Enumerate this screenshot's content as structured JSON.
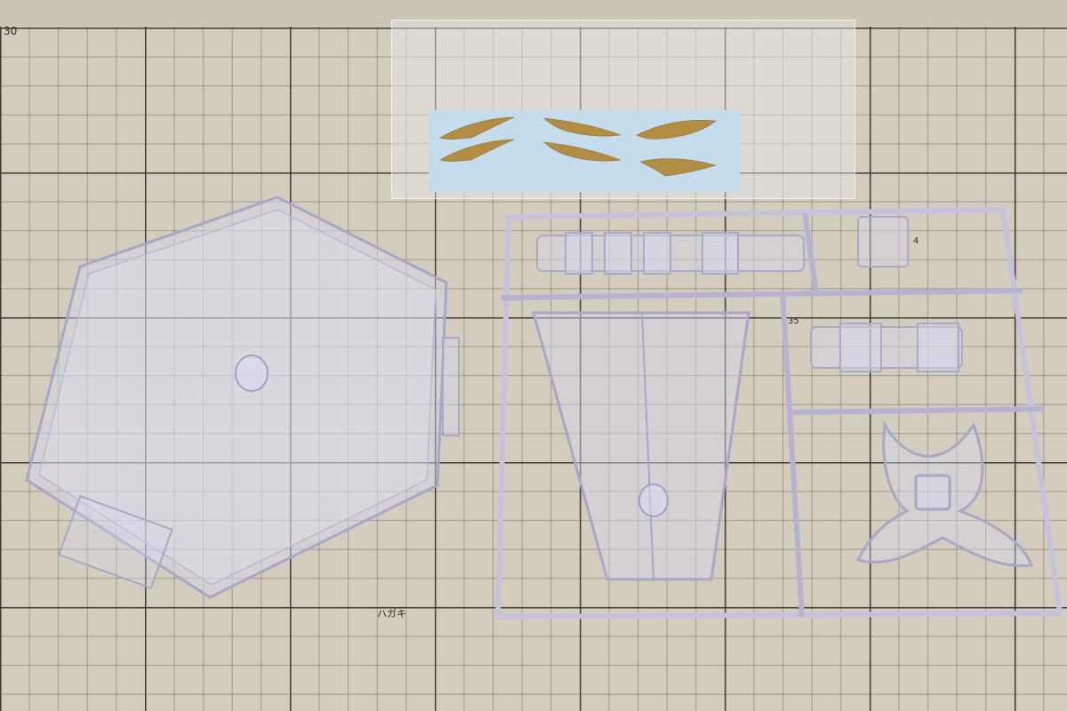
{
  "mat": {
    "number_label": "30",
    "postcard_label": "ハガキ",
    "side_numbers": [
      "4",
      "35"
    ]
  },
  "colors": {
    "mat": "#d3cdbd",
    "grid": "#3c3c3a",
    "plastic": "#c9c9e6",
    "decal_sheet": "#c4dcec",
    "decal_gold": "#b08a3a"
  },
  "objects": [
    {
      "name": "hexagon-stand-base"
    },
    {
      "name": "decal-sheet"
    },
    {
      "name": "runner-frame"
    },
    {
      "name": "trapezoid-arm-part"
    },
    {
      "name": "x-shaped-stand-part"
    }
  ]
}
